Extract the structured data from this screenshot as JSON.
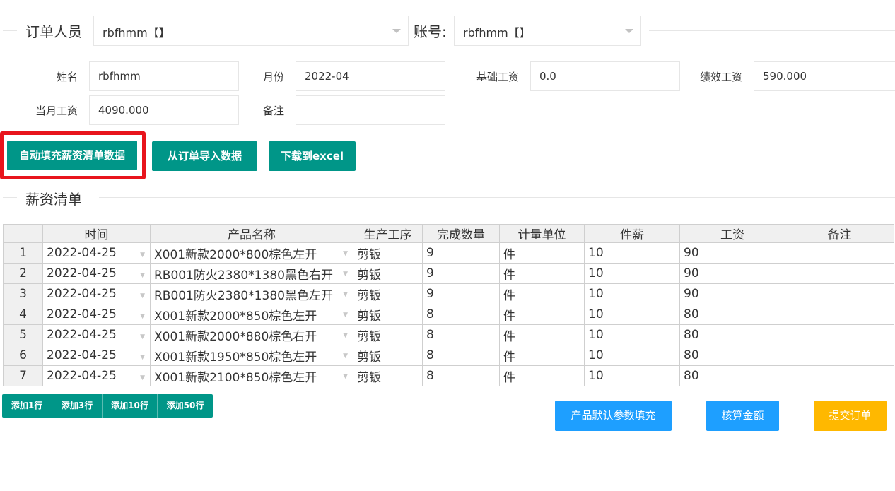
{
  "header": {
    "order_person_label": "订单人员",
    "order_person_value": "rbfhmm【】",
    "account_label": "账号:",
    "account_value": "rbfhmm【】"
  },
  "form": {
    "name_label": "姓名",
    "name_value": "rbfhmm",
    "month_label": "月份",
    "month_value": "2022-04",
    "base_salary_label": "基础工资",
    "base_salary_value": "0.0",
    "perf_salary_label": "绩效工资",
    "perf_salary_value": "590.000",
    "month_salary_label": "当月工资",
    "month_salary_value": "4090.000",
    "remark_label": "备注",
    "remark_value": ""
  },
  "actions": {
    "auto_fill": "自动填充薪资清单数据",
    "import_order": "从订单导入数据",
    "download_excel": "下载到excel"
  },
  "section": {
    "title": "薪资清单"
  },
  "table": {
    "columns": [
      "时间",
      "产品名称",
      "生产工序",
      "完成数量",
      "计量单位",
      "件薪",
      "工资",
      "备注"
    ],
    "rows": [
      [
        "1",
        "2022-04-25",
        "X001新款2000*800棕色左开",
        "剪钣",
        "9",
        "件",
        "10",
        "90",
        ""
      ],
      [
        "2",
        "2022-04-25",
        "RB001防火2380*1380黑色右开",
        "剪钣",
        "9",
        "件",
        "10",
        "90",
        ""
      ],
      [
        "3",
        "2022-04-25",
        "RB001防火2380*1380黑色左开",
        "剪钣",
        "9",
        "件",
        "10",
        "90",
        ""
      ],
      [
        "4",
        "2022-04-25",
        "X001新款2000*850棕色左开",
        "剪钣",
        "8",
        "件",
        "10",
        "80",
        ""
      ],
      [
        "5",
        "2022-04-25",
        "X001新款2000*880棕色右开",
        "剪钣",
        "8",
        "件",
        "10",
        "80",
        ""
      ],
      [
        "6",
        "2022-04-25",
        "X001新款1950*850棕色左开",
        "剪钣",
        "8",
        "件",
        "10",
        "80",
        ""
      ],
      [
        "7",
        "2022-04-25",
        "X001新款2100*850棕色左开",
        "剪钣",
        "8",
        "件",
        "10",
        "80",
        ""
      ]
    ]
  },
  "add_rows": [
    "添加1行",
    "添加3行",
    "添加10行",
    "添加50行"
  ],
  "bottom": {
    "default_fill": "产品默认参数填充",
    "calc_amount": "核算金额",
    "submit_order": "提交订单"
  },
  "colors": {
    "teal": "#009688",
    "blue": "#1E9FFF",
    "orange": "#FFB800",
    "highlight_red": "#e8141c"
  }
}
